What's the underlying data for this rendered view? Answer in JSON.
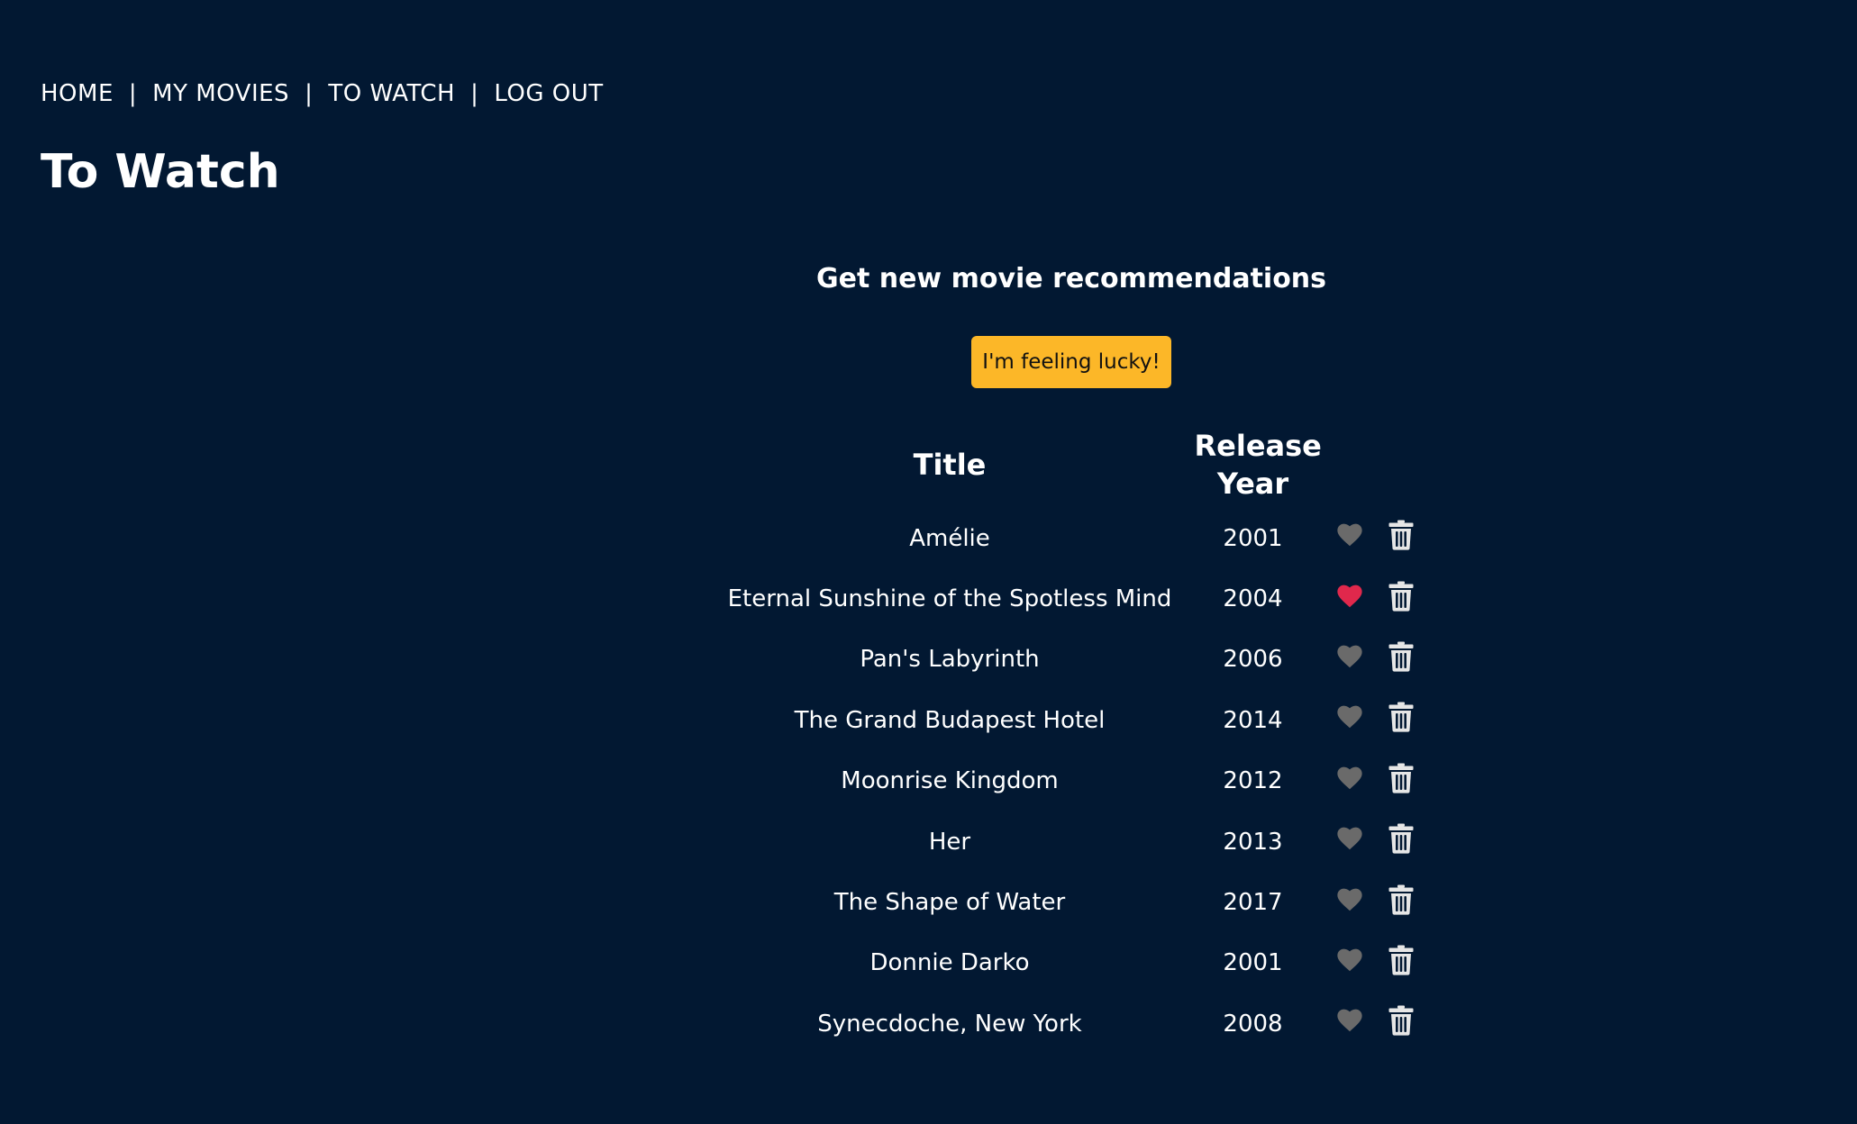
{
  "nav": {
    "items": [
      {
        "label": "HOME"
      },
      {
        "label": "MY MOVIES"
      },
      {
        "label": "TO WATCH"
      },
      {
        "label": "LOG OUT"
      }
    ],
    "separator": "|"
  },
  "page": {
    "title": "To Watch"
  },
  "recommendations": {
    "heading": "Get new movie recommendations",
    "button_label": "I'm feeling lucky!"
  },
  "table": {
    "headers": {
      "title": "Title",
      "year": "Release Year"
    },
    "rows": [
      {
        "title": "Amélie",
        "year": "2001",
        "favorite": false
      },
      {
        "title": "Eternal Sunshine of the Spotless Mind",
        "year": "2004",
        "favorite": true
      },
      {
        "title": "Pan's Labyrinth",
        "year": "2006",
        "favorite": false
      },
      {
        "title": "The Grand Budapest Hotel",
        "year": "2014",
        "favorite": false
      },
      {
        "title": "Moonrise Kingdom",
        "year": "2012",
        "favorite": false
      },
      {
        "title": "Her",
        "year": "2013",
        "favorite": false
      },
      {
        "title": "The Shape of Water",
        "year": "2017",
        "favorite": false
      },
      {
        "title": "Donnie Darko",
        "year": "2001",
        "favorite": false
      },
      {
        "title": "Synecdoche, New York",
        "year": "2008",
        "favorite": false
      }
    ]
  },
  "colors": {
    "background": "#021832",
    "accent_button": "#fcb728",
    "heart_active": "#e0284c",
    "heart_inactive": "#6a6a6a",
    "trash": "#e6e6e6"
  },
  "icons": {
    "favorite": "heart-icon",
    "delete": "trash-icon"
  }
}
